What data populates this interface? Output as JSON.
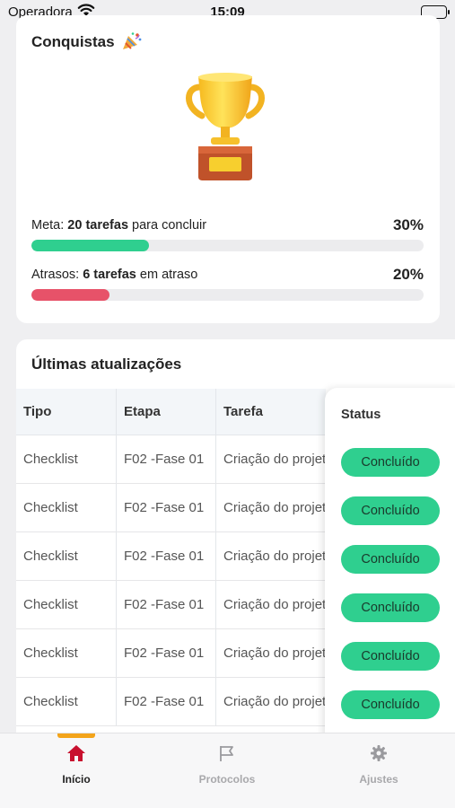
{
  "status_bar": {
    "carrier": "Operadora",
    "time": "15:09"
  },
  "achievements": {
    "title": "Conquistas",
    "goal": {
      "prefix": "Meta: ",
      "count": "20 tarefas",
      "suffix": " para concluir",
      "percent": "30%",
      "progress": 0.3,
      "color": "#2fcf8f"
    },
    "delays": {
      "prefix": "Atrasos: ",
      "count": "6 tarefas",
      "suffix": " em atraso",
      "percent": "20%",
      "progress": 0.2,
      "color": "#e75269"
    }
  },
  "updates": {
    "title": "Últimas atualizações",
    "columns": [
      "Tipo",
      "Etapa",
      "Tarefa",
      "Status"
    ],
    "rows": [
      {
        "tipo": "Checklist",
        "etapa": "F02 -Fase 01",
        "tarefa": "Criação do projeto",
        "status": "Concluído"
      },
      {
        "tipo": "Checklist",
        "etapa": "F02 -Fase 01",
        "tarefa": "Criação do projeto",
        "status": "Concluído"
      },
      {
        "tipo": "Checklist",
        "etapa": "F02 -Fase 01",
        "tarefa": "Criação do projeto",
        "status": "Concluído"
      },
      {
        "tipo": "Checklist",
        "etapa": "F02 -Fase 01",
        "tarefa": "Criação do projeto",
        "status": "Concluído"
      },
      {
        "tipo": "Checklist",
        "etapa": "F02 -Fase 01",
        "tarefa": "Criação do projeto",
        "status": "Concluído"
      },
      {
        "tipo": "Checklist",
        "etapa": "F02 -Fase 01",
        "tarefa": "Criação do projeto",
        "status": "Concluído"
      }
    ]
  },
  "tabbar": {
    "items": [
      {
        "label": "Início",
        "icon": "home-icon",
        "active": true
      },
      {
        "label": "Protocolos",
        "icon": "flag-icon",
        "active": false
      },
      {
        "label": "Ajustes",
        "icon": "gear-icon",
        "active": false
      }
    ],
    "accent": "#f3a41b",
    "active_icon_color": "#c8102e"
  }
}
